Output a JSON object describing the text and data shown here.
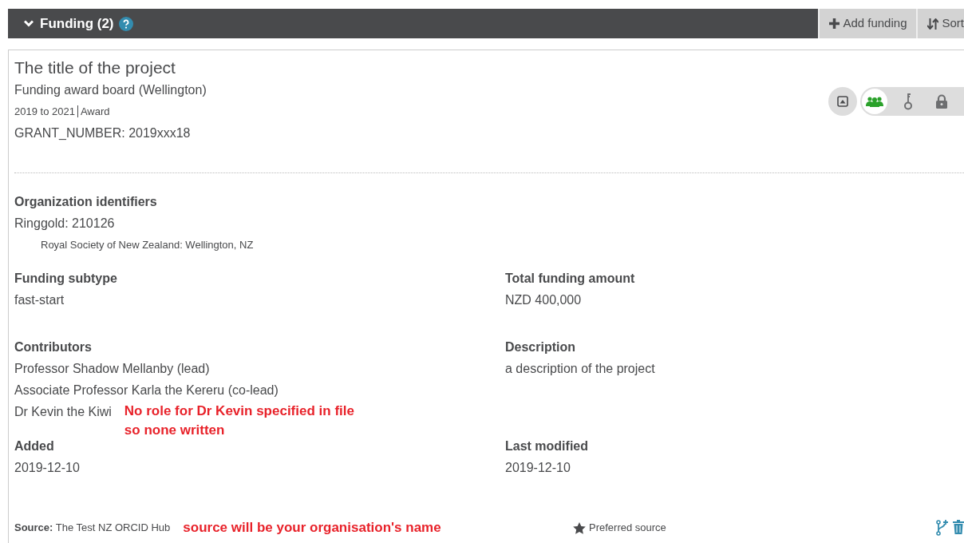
{
  "section": {
    "title": "Funding (2)",
    "expanded": true
  },
  "actions": [
    {
      "kind": "add",
      "label": "Add funding"
    },
    {
      "kind": "sort",
      "label": "Sort"
    }
  ],
  "funding": {
    "title": "The title of the project",
    "organization": "Funding award board (Wellington)",
    "dates": "2019 to 2021",
    "type": "Award",
    "grant": "GRANT_NUMBER: 2019xxx18",
    "visibility": [
      {
        "kind": "everyone",
        "selected": true
      },
      {
        "kind": "trusted",
        "selected": false
      },
      {
        "kind": "private",
        "selected": false
      }
    ]
  },
  "org_identifiers": {
    "heading": "Organization identifiers",
    "value": "Ringgold: 210126",
    "note": "Royal Society of New Zealand: Wellington, NZ"
  },
  "subtype": {
    "heading": "Funding subtype",
    "value": "fast-start"
  },
  "amount": {
    "heading": "Total funding amount",
    "value": "NZD 400,000"
  },
  "contributors": {
    "heading": "Contributors",
    "items": [
      "Professor Shadow Mellanby (lead)",
      "Associate Professor Karla the Kereru (co-lead)",
      "Dr Kevin the Kiwi"
    ],
    "annotation": "No role for Dr Kevin specified in file so none written"
  },
  "description": {
    "heading": "Description",
    "value": "a description of the project"
  },
  "added": {
    "heading": "Added",
    "value": "2019-12-10"
  },
  "modified": {
    "heading": "Last modified",
    "value": "2019-12-10"
  },
  "source": {
    "label": "Source:",
    "value": "The Test NZ ORCID Hub",
    "annotation": "source will be your organisation's name",
    "preferred": "Preferred source"
  }
}
